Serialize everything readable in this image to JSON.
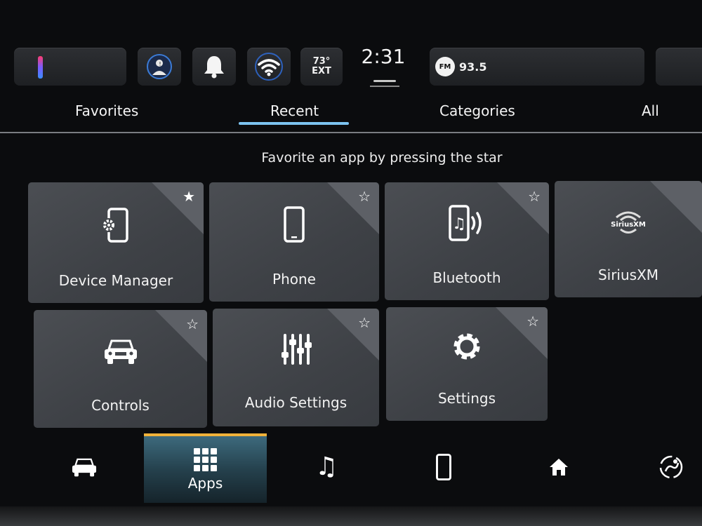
{
  "status_bar": {
    "temperature": "73°",
    "temperature_unit": "EXT",
    "time": "2:31",
    "radio_band": "FM",
    "radio_frequency": "93.5"
  },
  "tabs": [
    {
      "label": "Favorites",
      "active": false
    },
    {
      "label": "Recent",
      "active": true
    },
    {
      "label": "Categories",
      "active": false
    },
    {
      "label": "All",
      "active": false
    }
  ],
  "hint": "Favorite an app by pressing the star",
  "apps": [
    {
      "label": "Device Manager",
      "icon": "device-manager-icon",
      "favorited": true
    },
    {
      "label": "Phone",
      "icon": "phone-icon",
      "favorited": false
    },
    {
      "label": "Bluetooth",
      "icon": "bluetooth-audio-icon",
      "favorited": false
    },
    {
      "label": "SiriusXM",
      "icon": "siriusxm-logo",
      "favorited": false
    },
    {
      "label": "Controls",
      "icon": "car-icon",
      "favorited": false
    },
    {
      "label": "Audio Settings",
      "icon": "sliders-icon",
      "favorited": false
    },
    {
      "label": "Settings",
      "icon": "gear-icon",
      "favorited": false
    }
  ],
  "icons": {
    "star_filled": "★",
    "star_outline": "☆",
    "music": "♫"
  },
  "siriusxm_logo_text": "SiriusXM",
  "bottom_nav": {
    "apps_label": "Apps"
  },
  "colors": {
    "accent_tab": "#7cc3f0",
    "nav_active_top": "#f0b23a"
  }
}
